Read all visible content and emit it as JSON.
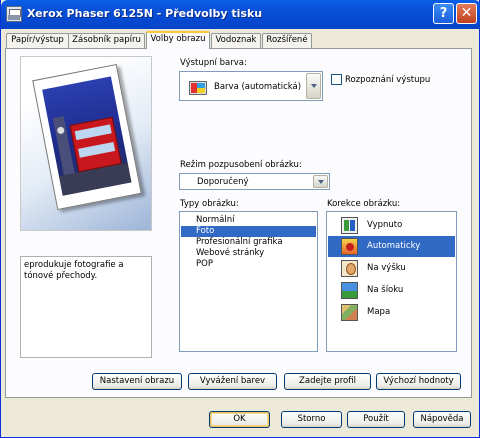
{
  "window": {
    "title": "Xerox Phaser 6125N - Předvolby tisku",
    "help_glyph": "?",
    "close_glyph": "✕"
  },
  "tabs": [
    {
      "label": "Papír/výstup",
      "active": false
    },
    {
      "label": "Zásobník papíru",
      "active": false
    },
    {
      "label": "Volby obrazu",
      "active": true
    },
    {
      "label": "Vodoznak",
      "active": false
    },
    {
      "label": "Rozšířené",
      "active": false
    }
  ],
  "preview": {
    "description": "eprodukuje fotografie a tónové přechody."
  },
  "output_color": {
    "label": "Výstupní barva:",
    "value": "Barva (automatická)",
    "icon": "color-printing-icon"
  },
  "output_detection": {
    "label": "Rozpoznání výstupu",
    "checked": false
  },
  "adjustment_mode": {
    "label": "Režim pozpusobení obrázku:",
    "value": "Doporučený"
  },
  "image_types": {
    "label": "Typy obrázku:",
    "items": [
      "Normální",
      "Foto",
      "Profesionální grafika",
      "Webové stránky",
      "POP"
    ],
    "selected": "Foto"
  },
  "image_correction": {
    "label": "Korekce obrázku:",
    "items": [
      {
        "label": "Vypnuto",
        "icon": "correction-off-icon"
      },
      {
        "label": "Automaticky",
        "icon": "correction-auto-icon"
      },
      {
        "label": "Na výšku",
        "icon": "portrait-icon"
      },
      {
        "label": "Na šíoku",
        "icon": "landscape-icon"
      },
      {
        "label": "Mapa",
        "icon": "map-icon"
      }
    ],
    "selected": "Automaticky"
  },
  "panel_buttons": {
    "image_settings": "Nastavení obrazu",
    "color_balance": "Vyvážení barev",
    "enter_profile": "Zadejte profil",
    "defaults": "Výchozí hodnoty"
  },
  "dialog_buttons": {
    "ok": "OK",
    "cancel": "Storno",
    "apply": "Použít",
    "help": "Nápověda"
  },
  "colors": {
    "titlebar": "#0a52d9",
    "selection": "#316ac5",
    "tab_highlight": "#ffc73c",
    "dialog_bg": "#ece9d8"
  }
}
